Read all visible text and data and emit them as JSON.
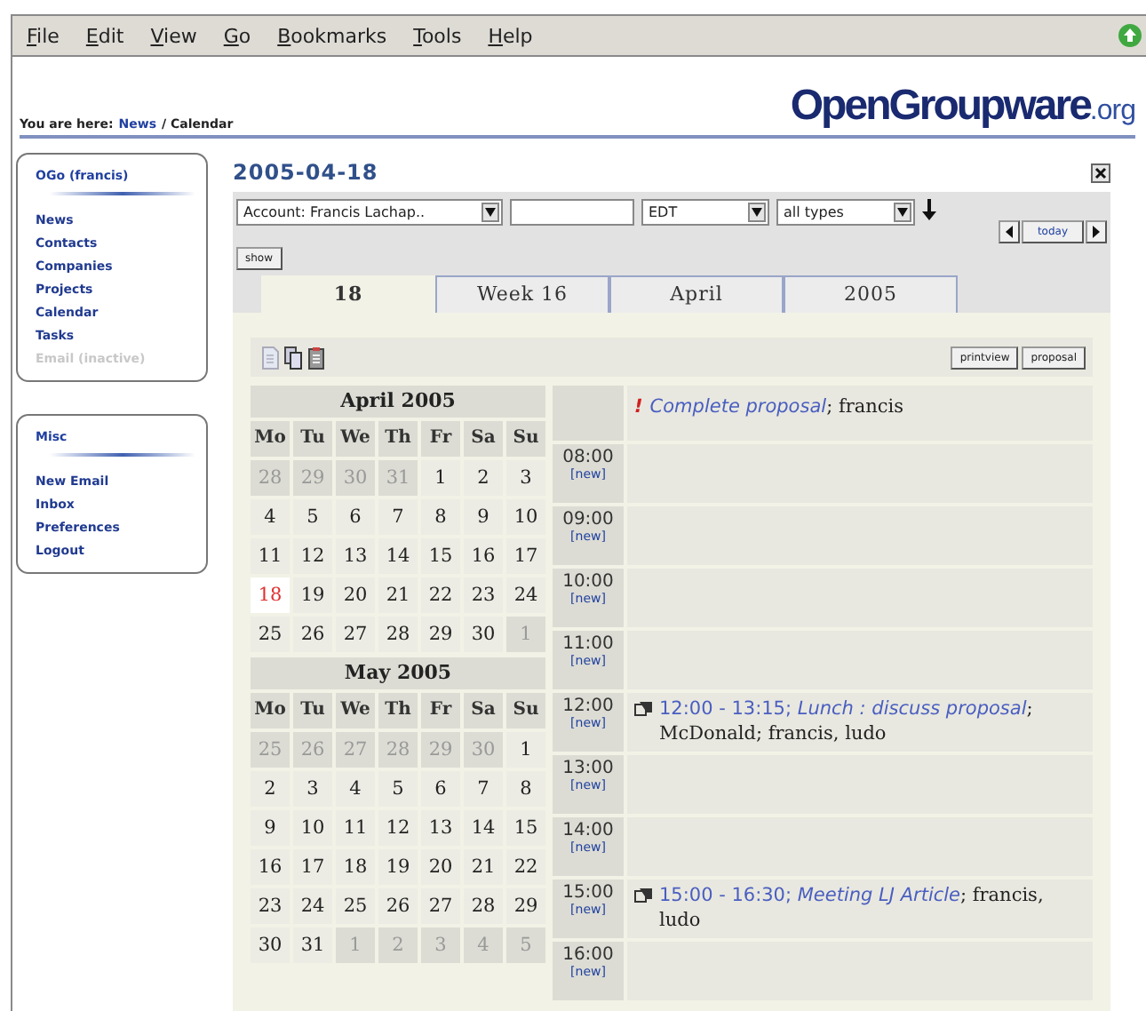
{
  "menu": [
    "File",
    "Edit",
    "View",
    "Go",
    "Bookmarks",
    "Tools",
    "Help"
  ],
  "breadcrumb": {
    "label": "You are here:",
    "link": "News",
    "current": "/ Calendar"
  },
  "logo": {
    "main": "OpenGroupware",
    "suffix": ".org"
  },
  "sidebar": [
    {
      "title": "OGo (francis)",
      "items": [
        {
          "label": "News",
          "disabled": false
        },
        {
          "label": "Contacts",
          "disabled": false
        },
        {
          "label": "Companies",
          "disabled": false
        },
        {
          "label": "Projects",
          "disabled": false
        },
        {
          "label": "Calendar",
          "disabled": false
        },
        {
          "label": "Tasks",
          "disabled": false
        },
        {
          "label": "Email (inactive)",
          "disabled": true
        }
      ]
    },
    {
      "title": "Misc",
      "items": [
        {
          "label": "New Email",
          "disabled": false
        },
        {
          "label": "Inbox",
          "disabled": false
        },
        {
          "label": "Preferences",
          "disabled": false
        },
        {
          "label": "Logout",
          "disabled": false
        }
      ]
    }
  ],
  "page_title": "2005-04-18",
  "filters": {
    "account": "Account: Francis Lachap..",
    "timezone": "EDT",
    "types": "all types",
    "show": "show",
    "today": "today"
  },
  "tabs": [
    {
      "label": "18",
      "selected": true
    },
    {
      "label": "Week 16",
      "selected": false
    },
    {
      "label": "April",
      "selected": false
    },
    {
      "label": "2005",
      "selected": false
    }
  ],
  "actions": [
    "printview",
    "proposal"
  ],
  "mini_calendars": [
    {
      "title": "April 2005",
      "weekdays": [
        "Mo",
        "Tu",
        "We",
        "Th",
        "Fr",
        "Sa",
        "Su"
      ],
      "days": [
        {
          "d": "28",
          "muted": true,
          "today": false
        },
        {
          "d": "29",
          "muted": true,
          "today": false
        },
        {
          "d": "30",
          "muted": true,
          "today": false
        },
        {
          "d": "31",
          "muted": true,
          "today": false
        },
        {
          "d": "1",
          "muted": false,
          "today": false
        },
        {
          "d": "2",
          "muted": false,
          "today": false
        },
        {
          "d": "3",
          "muted": false,
          "today": false
        },
        {
          "d": "4",
          "muted": false,
          "today": false
        },
        {
          "d": "5",
          "muted": false,
          "today": false
        },
        {
          "d": "6",
          "muted": false,
          "today": false
        },
        {
          "d": "7",
          "muted": false,
          "today": false
        },
        {
          "d": "8",
          "muted": false,
          "today": false
        },
        {
          "d": "9",
          "muted": false,
          "today": false
        },
        {
          "d": "10",
          "muted": false,
          "today": false
        },
        {
          "d": "11",
          "muted": false,
          "today": false
        },
        {
          "d": "12",
          "muted": false,
          "today": false
        },
        {
          "d": "13",
          "muted": false,
          "today": false
        },
        {
          "d": "14",
          "muted": false,
          "today": false
        },
        {
          "d": "15",
          "muted": false,
          "today": false
        },
        {
          "d": "16",
          "muted": false,
          "today": false
        },
        {
          "d": "17",
          "muted": false,
          "today": false
        },
        {
          "d": "18",
          "muted": false,
          "today": true
        },
        {
          "d": "19",
          "muted": false,
          "today": false
        },
        {
          "d": "20",
          "muted": false,
          "today": false
        },
        {
          "d": "21",
          "muted": false,
          "today": false
        },
        {
          "d": "22",
          "muted": false,
          "today": false
        },
        {
          "d": "23",
          "muted": false,
          "today": false
        },
        {
          "d": "24",
          "muted": false,
          "today": false
        },
        {
          "d": "25",
          "muted": false,
          "today": false
        },
        {
          "d": "26",
          "muted": false,
          "today": false
        },
        {
          "d": "27",
          "muted": false,
          "today": false
        },
        {
          "d": "28",
          "muted": false,
          "today": false
        },
        {
          "d": "29",
          "muted": false,
          "today": false
        },
        {
          "d": "30",
          "muted": false,
          "today": false
        },
        {
          "d": "1",
          "muted": true,
          "today": false
        }
      ]
    },
    {
      "title": "May 2005",
      "weekdays": [
        "Mo",
        "Tu",
        "We",
        "Th",
        "Fr",
        "Sa",
        "Su"
      ],
      "days": [
        {
          "d": "25",
          "muted": true,
          "today": false
        },
        {
          "d": "26",
          "muted": true,
          "today": false
        },
        {
          "d": "27",
          "muted": true,
          "today": false
        },
        {
          "d": "28",
          "muted": true,
          "today": false
        },
        {
          "d": "29",
          "muted": true,
          "today": false
        },
        {
          "d": "30",
          "muted": true,
          "today": false
        },
        {
          "d": "1",
          "muted": false,
          "today": false
        },
        {
          "d": "2",
          "muted": false,
          "today": false
        },
        {
          "d": "3",
          "muted": false,
          "today": false
        },
        {
          "d": "4",
          "muted": false,
          "today": false
        },
        {
          "d": "5",
          "muted": false,
          "today": false
        },
        {
          "d": "6",
          "muted": false,
          "today": false
        },
        {
          "d": "7",
          "muted": false,
          "today": false
        },
        {
          "d": "8",
          "muted": false,
          "today": false
        },
        {
          "d": "9",
          "muted": false,
          "today": false
        },
        {
          "d": "10",
          "muted": false,
          "today": false
        },
        {
          "d": "11",
          "muted": false,
          "today": false
        },
        {
          "d": "12",
          "muted": false,
          "today": false
        },
        {
          "d": "13",
          "muted": false,
          "today": false
        },
        {
          "d": "14",
          "muted": false,
          "today": false
        },
        {
          "d": "15",
          "muted": false,
          "today": false
        },
        {
          "d": "16",
          "muted": false,
          "today": false
        },
        {
          "d": "17",
          "muted": false,
          "today": false
        },
        {
          "d": "18",
          "muted": false,
          "today": false
        },
        {
          "d": "19",
          "muted": false,
          "today": false
        },
        {
          "d": "20",
          "muted": false,
          "today": false
        },
        {
          "d": "21",
          "muted": false,
          "today": false
        },
        {
          "d": "22",
          "muted": false,
          "today": false
        },
        {
          "d": "23",
          "muted": false,
          "today": false
        },
        {
          "d": "24",
          "muted": false,
          "today": false
        },
        {
          "d": "25",
          "muted": false,
          "today": false
        },
        {
          "d": "26",
          "muted": false,
          "today": false
        },
        {
          "d": "27",
          "muted": false,
          "today": false
        },
        {
          "d": "28",
          "muted": false,
          "today": false
        },
        {
          "d": "29",
          "muted": false,
          "today": false
        },
        {
          "d": "30",
          "muted": false,
          "today": false
        },
        {
          "d": "31",
          "muted": false,
          "today": false
        },
        {
          "d": "1",
          "muted": true,
          "today": false
        },
        {
          "d": "2",
          "muted": true,
          "today": false
        },
        {
          "d": "3",
          "muted": true,
          "today": false
        },
        {
          "d": "4",
          "muted": true,
          "today": false
        },
        {
          "d": "5",
          "muted": true,
          "today": false
        }
      ]
    }
  ],
  "all_day": {
    "priority": "!",
    "title": "Complete proposal",
    "details": "; francis"
  },
  "hours": [
    {
      "time": "08:00",
      "new": "[new]"
    },
    {
      "time": "09:00",
      "new": "[new]"
    },
    {
      "time": "10:00",
      "new": "[new]"
    },
    {
      "time": "11:00",
      "new": "[new]"
    },
    {
      "time": "12:00",
      "new": "[new]",
      "events": [
        {
          "span": "12:00 - 13:15;",
          "title": "Lunch : discuss proposal",
          "details": "; McDonald; francis, ludo"
        }
      ]
    },
    {
      "time": "13:00",
      "new": "[new]"
    },
    {
      "time": "14:00",
      "new": "[new]"
    },
    {
      "time": "15:00",
      "new": "[new]",
      "events": [
        {
          "span": "15:00 - 16:30;",
          "title": "Meeting LJ Article",
          "details": "; francis, ludo"
        }
      ]
    },
    {
      "time": "16:00",
      "new": "[new]"
    }
  ]
}
